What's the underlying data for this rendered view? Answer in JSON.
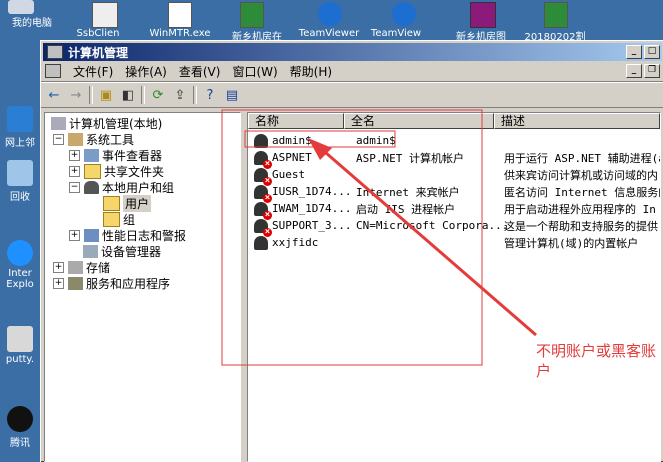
{
  "desktop": {
    "top_icons": [
      "SsbClien",
      "WinMTR.exe",
      "新乡机房在",
      "TeamViewer",
      "TeamView",
      "新乡机房图",
      "20180202割"
    ],
    "left_icons": [
      "我的电脑",
      "网上邻",
      "回收",
      "Inter Explo",
      "putty.",
      "腾讯"
    ]
  },
  "window": {
    "title": "计算机管理",
    "menu": [
      "文件(F)",
      "操作(A)",
      "查看(V)",
      "窗口(W)",
      "帮助(H)"
    ],
    "toolbar_icons": [
      "back-icon",
      "forward-icon",
      "up-folder-icon",
      "show-tree-icon",
      "refresh-icon",
      "export-icon",
      "help-icon",
      "properties-icon"
    ]
  },
  "tree": {
    "root": "计算机管理(本地)",
    "system_tools": "系统工具",
    "event_viewer": "事件查看器",
    "shared_folders": "共享文件夹",
    "local_users_groups": "本地用户和组",
    "users": "用户",
    "groups": "组",
    "perf_logs": "性能日志和警报",
    "device_manager": "设备管理器",
    "storage": "存储",
    "services_apps": "服务和应用程序"
  },
  "list": {
    "columns": [
      "名称",
      "全名",
      "描述"
    ],
    "rows": [
      {
        "name": "admin$",
        "full": "admin$",
        "desc": ""
      },
      {
        "name": "ASPNET",
        "full": "ASP.NET 计算机帐户",
        "desc": "用于运行 ASP.NET 辅助进程(a"
      },
      {
        "name": "Guest",
        "full": "",
        "desc": "供来宾访问计算机或访问域的内"
      },
      {
        "name": "IUSR_1D74...",
        "full": "Internet 来宾帐户",
        "desc": "匿名访问 Internet 信息服务的"
      },
      {
        "name": "IWAM_1D74...",
        "full": "启动 IIS 进程帐户",
        "desc": "用于启动进程外应用程序的 In"
      },
      {
        "name": "SUPPORT_3...",
        "full": "CN=Microsoft Corpora...",
        "desc": "这是一个帮助和支持服务的提供"
      },
      {
        "name": "xxjfidc",
        "full": "",
        "desc": "管理计算机(域)的内置帐户"
      }
    ]
  },
  "annotation": {
    "text": "不明账户或黑客账户",
    "color": "#e43b3b"
  }
}
